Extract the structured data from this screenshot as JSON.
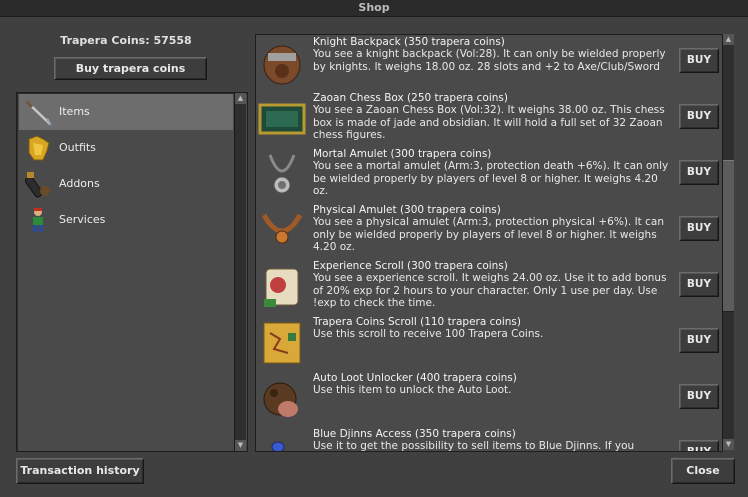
{
  "window": {
    "title": "Shop"
  },
  "balance": {
    "label": "Trapera Coins: 57558"
  },
  "buy_coins_label": "Buy trapera coins",
  "categories": [
    {
      "label": "Items",
      "icon": "spear-icon",
      "selected": true
    },
    {
      "label": "Outfits",
      "icon": "golden-armor-icon",
      "selected": false
    },
    {
      "label": "Addons",
      "icon": "cannon-icon",
      "selected": false
    },
    {
      "label": "Services",
      "icon": "character-icon",
      "selected": false
    }
  ],
  "items": [
    {
      "name": "Knight Backpack (350 trapera coins)",
      "desc": "You see a knight backpack (Vol:28). It can only be wielded properly by knights. It weighs 18.00 oz. 28 slots and +2 to Axe/Club/Sword",
      "icon": "backpack-icon",
      "buy": "BUY"
    },
    {
      "name": "Zaoan Chess Box (250 trapera coins)",
      "desc": "You see a Zaoan Chess Box (Vol:32). It weighs 38.00 oz. This chess box is made of jade and obsidian. It will hold a full set of 32 Zaoan chess figures.",
      "icon": "chess-box-icon",
      "buy": "BUY"
    },
    {
      "name": "Mortal Amulet (300 trapera coins)",
      "desc": "You see a mortal amulet (Arm:3, protection death +6%). It can only be wielded properly by players of level 8 or higher. It weighs 4.20 oz.",
      "icon": "amulet-icon",
      "buy": "BUY"
    },
    {
      "name": "Physical Amulet (300 trapera coins)",
      "desc": "You see a physical amulet (Arm:3, protection physical +6%). It can only be wielded properly by players of level 8 or higher. It weighs 4.20 oz.",
      "icon": "amulet-icon",
      "buy": "BUY"
    },
    {
      "name": "Experience Scroll (300 trapera coins)",
      "desc": "You see a experience scroll. It weighs 24.00 oz. Use it to add bonus of 20% exp for 2 hours to your character. Only 1 use per day. Use !exp to check the time.",
      "icon": "scroll-icon",
      "buy": "BUY"
    },
    {
      "name": "Trapera Coins Scroll (110 trapera coins)",
      "desc": "Use this scroll to receive 100 Trapera Coins.",
      "icon": "map-scroll-icon",
      "buy": "BUY"
    },
    {
      "name": "Auto Loot Unlocker (400 trapera coins)",
      "desc": "Use this item to unlock the Auto Loot.",
      "icon": "loot-bag-icon",
      "buy": "BUY"
    },
    {
      "name": "Blue Djinns Access (350 trapera coins)",
      "desc": "Use it to get the possibility to sell items to Blue Djinns. If you",
      "icon": "lamp-icon",
      "buy": "BUY"
    }
  ],
  "footer": {
    "transaction_label": "Transaction history",
    "close_label": "Close"
  }
}
